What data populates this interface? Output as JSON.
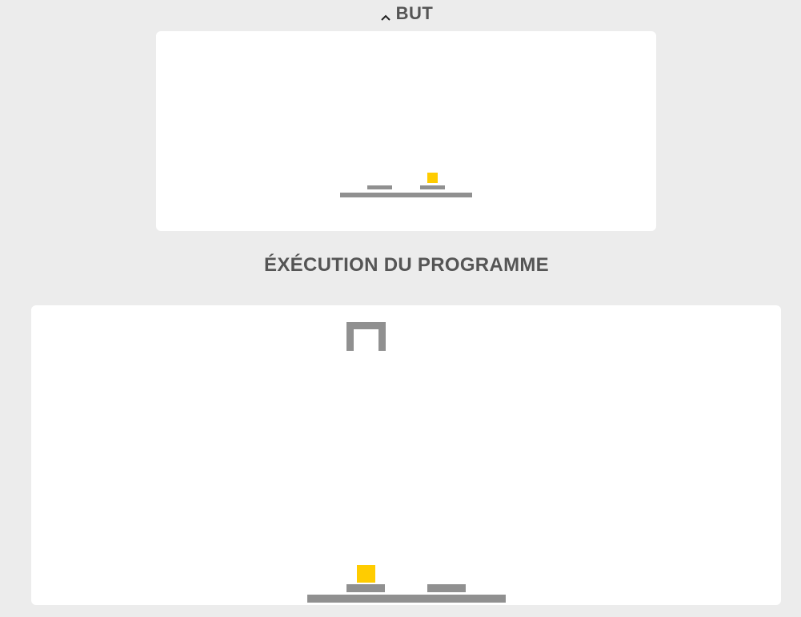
{
  "goal_section": {
    "title": "BUT",
    "toggle_icon": "chevron-up-icon"
  },
  "execution_section": {
    "title": "ÉXÉCUTION DU PROGRAMME"
  },
  "colors": {
    "background": "#ececec",
    "panel": "#ffffff",
    "platform": "#909090",
    "block": "#ffcc00",
    "heading": "#555555"
  },
  "scene": {
    "goal": {
      "crane": "none",
      "stacks": [
        {
          "slot": "left",
          "blocks": 0
        },
        {
          "slot": "right",
          "blocks": 1
        }
      ]
    },
    "execution": {
      "crane": "open-claw",
      "stacks": [
        {
          "slot": "left",
          "blocks": 1
        },
        {
          "slot": "right",
          "blocks": 0
        }
      ]
    }
  }
}
